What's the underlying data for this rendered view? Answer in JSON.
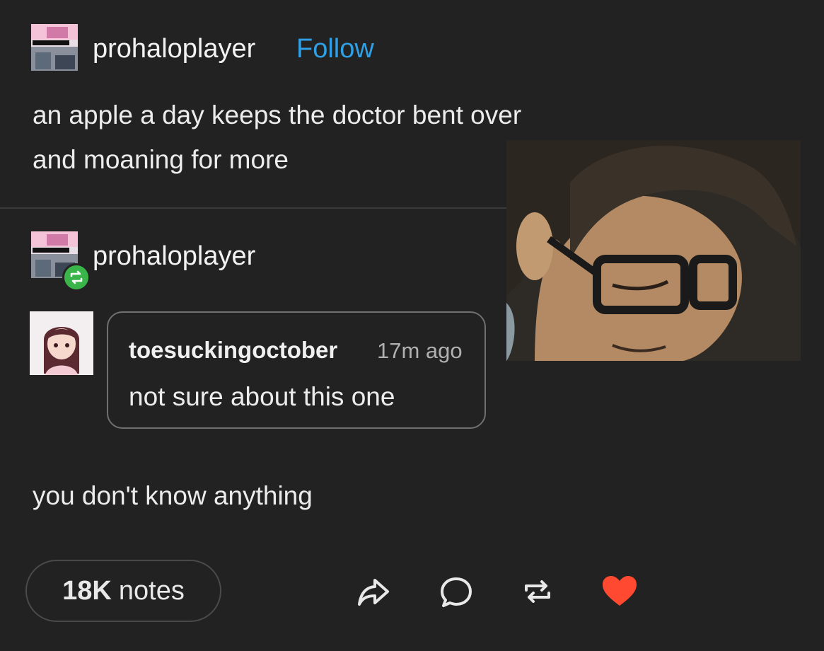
{
  "post": {
    "username": "prohaloplayer",
    "follow_label": "Follow",
    "body_lines": [
      "an apple a day keeps the doctor bent over",
      "and moaning for more"
    ]
  },
  "reblog": {
    "username": "prohaloplayer",
    "comment": {
      "username": "toesuckingoctober",
      "timestamp": "17m ago",
      "text": "not sure about this one"
    },
    "reply": "you don't know anything"
  },
  "footer": {
    "notes_count": "18K",
    "notes_label": "notes"
  },
  "colors": {
    "follow": "#2fa0e6",
    "reblog_badge": "#3ab54a",
    "heart": "#ff4930",
    "background": "#222222"
  },
  "icons": [
    "share-icon",
    "comment-icon",
    "reblog-icon",
    "heart-icon"
  ]
}
